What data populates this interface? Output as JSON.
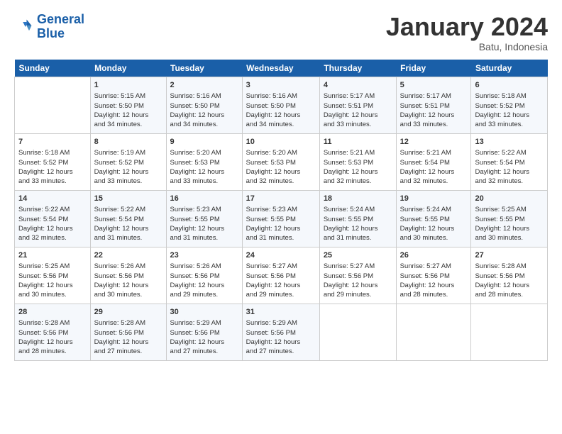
{
  "header": {
    "logo_line1": "General",
    "logo_line2": "Blue",
    "month": "January 2024",
    "location": "Batu, Indonesia"
  },
  "days_of_week": [
    "Sunday",
    "Monday",
    "Tuesday",
    "Wednesday",
    "Thursday",
    "Friday",
    "Saturday"
  ],
  "weeks": [
    [
      {
        "num": "",
        "info": ""
      },
      {
        "num": "1",
        "info": "Sunrise: 5:15 AM\nSunset: 5:50 PM\nDaylight: 12 hours\nand 34 minutes."
      },
      {
        "num": "2",
        "info": "Sunrise: 5:16 AM\nSunset: 5:50 PM\nDaylight: 12 hours\nand 34 minutes."
      },
      {
        "num": "3",
        "info": "Sunrise: 5:16 AM\nSunset: 5:50 PM\nDaylight: 12 hours\nand 34 minutes."
      },
      {
        "num": "4",
        "info": "Sunrise: 5:17 AM\nSunset: 5:51 PM\nDaylight: 12 hours\nand 33 minutes."
      },
      {
        "num": "5",
        "info": "Sunrise: 5:17 AM\nSunset: 5:51 PM\nDaylight: 12 hours\nand 33 minutes."
      },
      {
        "num": "6",
        "info": "Sunrise: 5:18 AM\nSunset: 5:52 PM\nDaylight: 12 hours\nand 33 minutes."
      }
    ],
    [
      {
        "num": "7",
        "info": "Sunrise: 5:18 AM\nSunset: 5:52 PM\nDaylight: 12 hours\nand 33 minutes."
      },
      {
        "num": "8",
        "info": "Sunrise: 5:19 AM\nSunset: 5:52 PM\nDaylight: 12 hours\nand 33 minutes."
      },
      {
        "num": "9",
        "info": "Sunrise: 5:20 AM\nSunset: 5:53 PM\nDaylight: 12 hours\nand 33 minutes."
      },
      {
        "num": "10",
        "info": "Sunrise: 5:20 AM\nSunset: 5:53 PM\nDaylight: 12 hours\nand 32 minutes."
      },
      {
        "num": "11",
        "info": "Sunrise: 5:21 AM\nSunset: 5:53 PM\nDaylight: 12 hours\nand 32 minutes."
      },
      {
        "num": "12",
        "info": "Sunrise: 5:21 AM\nSunset: 5:54 PM\nDaylight: 12 hours\nand 32 minutes."
      },
      {
        "num": "13",
        "info": "Sunrise: 5:22 AM\nSunset: 5:54 PM\nDaylight: 12 hours\nand 32 minutes."
      }
    ],
    [
      {
        "num": "14",
        "info": "Sunrise: 5:22 AM\nSunset: 5:54 PM\nDaylight: 12 hours\nand 32 minutes."
      },
      {
        "num": "15",
        "info": "Sunrise: 5:22 AM\nSunset: 5:54 PM\nDaylight: 12 hours\nand 31 minutes."
      },
      {
        "num": "16",
        "info": "Sunrise: 5:23 AM\nSunset: 5:55 PM\nDaylight: 12 hours\nand 31 minutes."
      },
      {
        "num": "17",
        "info": "Sunrise: 5:23 AM\nSunset: 5:55 PM\nDaylight: 12 hours\nand 31 minutes."
      },
      {
        "num": "18",
        "info": "Sunrise: 5:24 AM\nSunset: 5:55 PM\nDaylight: 12 hours\nand 31 minutes."
      },
      {
        "num": "19",
        "info": "Sunrise: 5:24 AM\nSunset: 5:55 PM\nDaylight: 12 hours\nand 30 minutes."
      },
      {
        "num": "20",
        "info": "Sunrise: 5:25 AM\nSunset: 5:55 PM\nDaylight: 12 hours\nand 30 minutes."
      }
    ],
    [
      {
        "num": "21",
        "info": "Sunrise: 5:25 AM\nSunset: 5:56 PM\nDaylight: 12 hours\nand 30 minutes."
      },
      {
        "num": "22",
        "info": "Sunrise: 5:26 AM\nSunset: 5:56 PM\nDaylight: 12 hours\nand 30 minutes."
      },
      {
        "num": "23",
        "info": "Sunrise: 5:26 AM\nSunset: 5:56 PM\nDaylight: 12 hours\nand 29 minutes."
      },
      {
        "num": "24",
        "info": "Sunrise: 5:27 AM\nSunset: 5:56 PM\nDaylight: 12 hours\nand 29 minutes."
      },
      {
        "num": "25",
        "info": "Sunrise: 5:27 AM\nSunset: 5:56 PM\nDaylight: 12 hours\nand 29 minutes."
      },
      {
        "num": "26",
        "info": "Sunrise: 5:27 AM\nSunset: 5:56 PM\nDaylight: 12 hours\nand 28 minutes."
      },
      {
        "num": "27",
        "info": "Sunrise: 5:28 AM\nSunset: 5:56 PM\nDaylight: 12 hours\nand 28 minutes."
      }
    ],
    [
      {
        "num": "28",
        "info": "Sunrise: 5:28 AM\nSunset: 5:56 PM\nDaylight: 12 hours\nand 28 minutes."
      },
      {
        "num": "29",
        "info": "Sunrise: 5:28 AM\nSunset: 5:56 PM\nDaylight: 12 hours\nand 27 minutes."
      },
      {
        "num": "30",
        "info": "Sunrise: 5:29 AM\nSunset: 5:56 PM\nDaylight: 12 hours\nand 27 minutes."
      },
      {
        "num": "31",
        "info": "Sunrise: 5:29 AM\nSunset: 5:56 PM\nDaylight: 12 hours\nand 27 minutes."
      },
      {
        "num": "",
        "info": ""
      },
      {
        "num": "",
        "info": ""
      },
      {
        "num": "",
        "info": ""
      }
    ]
  ]
}
